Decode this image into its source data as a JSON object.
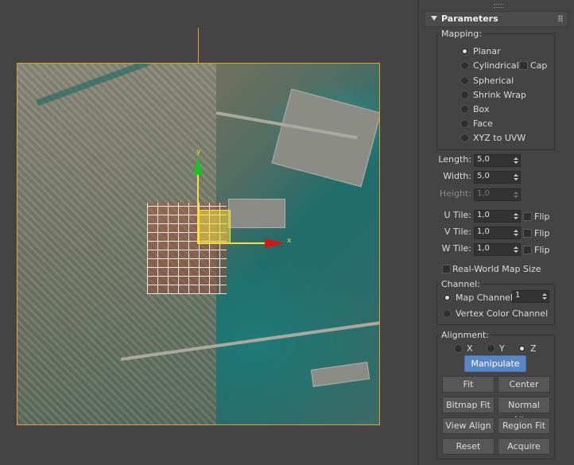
{
  "viewport": {
    "axis_x_label": "x",
    "axis_y_label": "y",
    "selection_color": "#e8a030"
  },
  "panel": {
    "title": "Parameters",
    "mapping": {
      "label": "Mapping:",
      "options": [
        {
          "label": "Planar",
          "selected": true
        },
        {
          "label": "Cylindrical",
          "selected": false
        },
        {
          "label": "Spherical",
          "selected": false
        },
        {
          "label": "Shrink Wrap",
          "selected": false
        },
        {
          "label": "Box",
          "selected": false
        },
        {
          "label": "Face",
          "selected": false
        },
        {
          "label": "XYZ to UVW",
          "selected": false
        }
      ],
      "cap_label": "Cap"
    },
    "dimensions": {
      "length_label": "Length:",
      "length_value": "5,0",
      "width_label": "Width:",
      "width_value": "5,0",
      "height_label": "Height:",
      "height_value": "1,0"
    },
    "tiles": {
      "u_label": "U Tile:",
      "u_value": "1,0",
      "v_label": "V Tile:",
      "v_value": "1,0",
      "w_label": "W Tile:",
      "w_value": "1,0",
      "flip_label": "Flip"
    },
    "real_world_label": "Real-World Map Size",
    "channel": {
      "label": "Channel:",
      "map_channel_label": "Map Channel:",
      "map_channel_value": "1",
      "vertex_color_label": "Vertex Color Channel"
    },
    "alignment": {
      "label": "Alignment:",
      "x_label": "X",
      "y_label": "Y",
      "z_label": "Z",
      "manipulate_label": "Manipulate",
      "fit_label": "Fit",
      "center_label": "Center",
      "bitmap_fit_label": "Bitmap Fit",
      "normal_align_label": "Normal Align",
      "view_align_label": "View Align",
      "region_fit_label": "Region Fit",
      "reset_label": "Reset",
      "acquire_label": "Acquire"
    },
    "accent_color": "#5b86c6"
  }
}
